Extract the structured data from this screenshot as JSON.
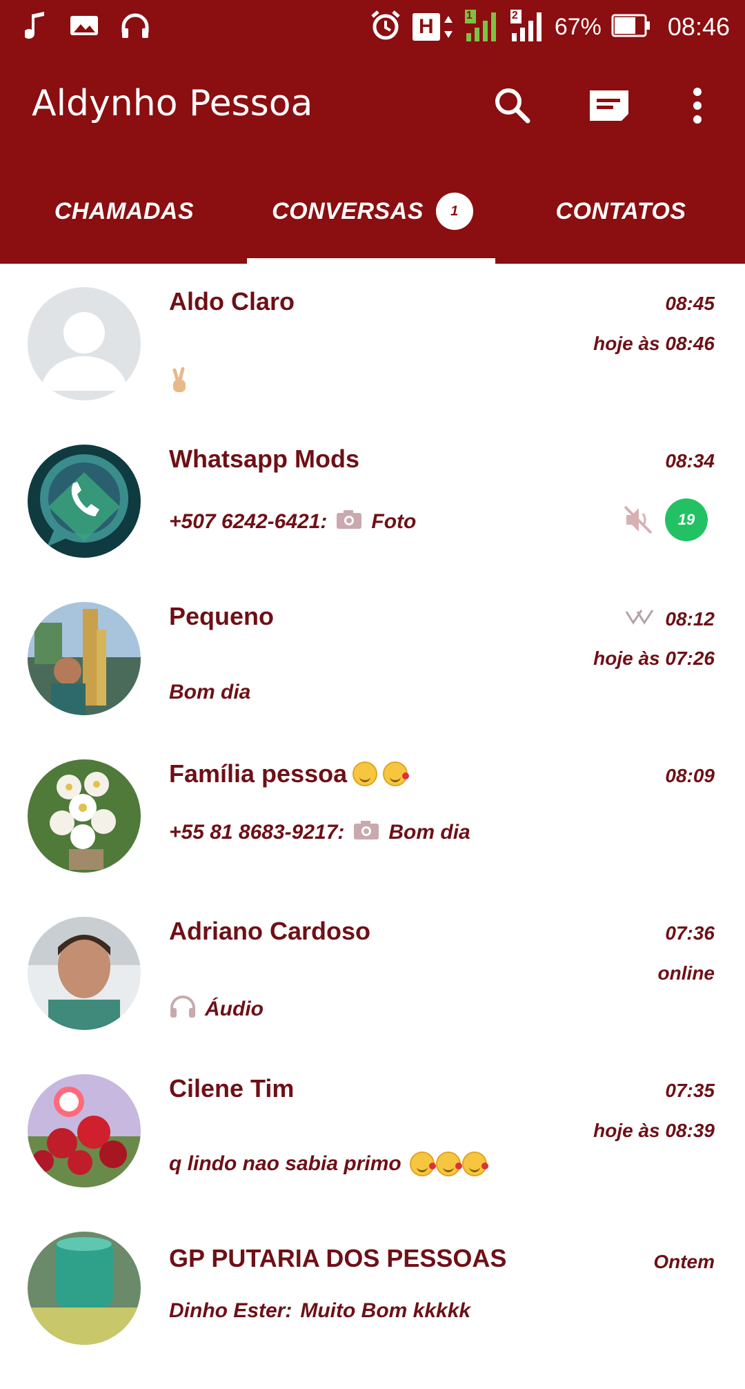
{
  "status_bar": {
    "battery": "67%",
    "time": "08:46",
    "network_type": "H",
    "sim1_label": "1",
    "sim2_label": "2",
    "icons": [
      "music-icon",
      "image-icon",
      "headset-icon",
      "alarm-icon",
      "network-icon",
      "signal-icon",
      "battery-icon"
    ]
  },
  "app_bar": {
    "title": "Aldynho Pessoa",
    "icons": [
      "search-icon",
      "new-chat-icon",
      "more-vert-icon"
    ]
  },
  "tabs": [
    {
      "label": "CHAMADAS",
      "active": false
    },
    {
      "label": "CONVERSAS",
      "active": true,
      "badge": "1"
    },
    {
      "label": "CONTATOS",
      "active": false
    }
  ],
  "chats": [
    {
      "name": "Aldo Claro",
      "time": "08:45",
      "status": "hoje às 08:46",
      "preview": "",
      "preview_icon": "victory-hand-icon"
    },
    {
      "name": "Whatsapp Mods",
      "time": "08:34",
      "preview_sender": "+507 6242-6421:",
      "preview": "Foto",
      "preview_icon": "camera-icon",
      "muted": true,
      "unread": "19"
    },
    {
      "name": "Pequeno",
      "time": "08:12",
      "time_icon": "double-check-icon",
      "status": "hoje às 07:26",
      "preview": "Bom dia"
    },
    {
      "name": "Família pessoa",
      "name_icons": [
        "smile-emoji-icon",
        "kiss-emoji-icon"
      ],
      "time": "08:09",
      "preview_sender": "+55 81 8683-9217:",
      "preview": "Bom dia",
      "preview_icon": "camera-icon"
    },
    {
      "name": "Adriano Cardoso",
      "time": "07:36",
      "status": "online",
      "preview": "Áudio",
      "preview_icon": "headphones-icon"
    },
    {
      "name": "Cilene Tim",
      "time": "07:35",
      "status": "hoje às 08:39",
      "preview": "q lindo nao sabia primo",
      "preview_emojis": [
        "kiss-emoji-icon",
        "kiss-emoji-icon",
        "kiss-emoji-icon"
      ]
    },
    {
      "name": "GP PUTARIA DOS  PESSOAS",
      "time": "Ontem",
      "preview_sender": "Dinho Ester:",
      "preview": "Muito Bom kkkkk"
    }
  ],
  "colors": {
    "primary": "#8b0e10",
    "text": "#6e1016",
    "unread_badge": "#22c264"
  }
}
